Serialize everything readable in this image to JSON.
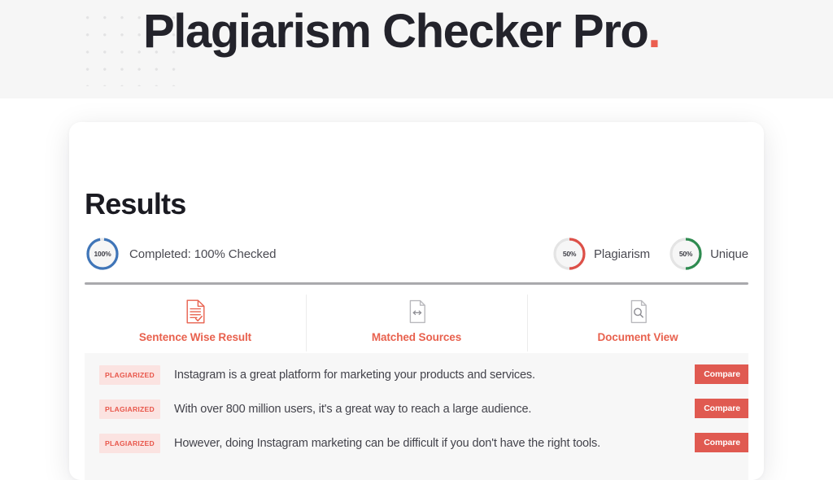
{
  "header": {
    "title_main": "Plagiarism Checker Pro",
    "title_accent": ".",
    "background_color": "#f6f6f6",
    "accent_color": "#eb5e4f",
    "dot_pattern_color": "#e3e3e4"
  },
  "card": {
    "page_title": "Results",
    "status": {
      "progress_label": "100%",
      "progress_text": "Completed: 100% Checked",
      "progress_color": "#3f75b8",
      "progress_percent": 100
    },
    "meters": [
      {
        "name": "plagiarism-meter",
        "value_label": "50%",
        "caption": "Plagiarism",
        "percent": 50,
        "color": "#dd5048"
      },
      {
        "name": "unique-meter",
        "value_label": "50%",
        "caption": "Unique",
        "percent": 50,
        "color": "#2e8b50"
      }
    ],
    "tabs": [
      {
        "label": "Sentence Wise Result",
        "icon": "document-check-icon",
        "active": true
      },
      {
        "label": "Matched Sources",
        "icon": "document-compare-icon",
        "active": false
      },
      {
        "label": "Document View",
        "icon": "document-search-icon",
        "active": false
      }
    ],
    "tab_active_color": "#e8614e",
    "results": [
      {
        "badge": "PLAGIARIZED",
        "sentence": "Instagram is a great platform for marketing your products and services.",
        "compare_label": "Compare"
      },
      {
        "badge": "PLAGIARIZED",
        "sentence": "With over 800 million users, it's a great way to reach a large audience.",
        "compare_label": "Compare"
      },
      {
        "badge": "PLAGIARIZED",
        "sentence": "However, doing Instagram marketing can be difficult if you don't have the right tools.",
        "compare_label": "Compare"
      }
    ],
    "badge_background": "#fbe3e1",
    "badge_color": "#e8564a",
    "compare_background": "#e05a51"
  }
}
